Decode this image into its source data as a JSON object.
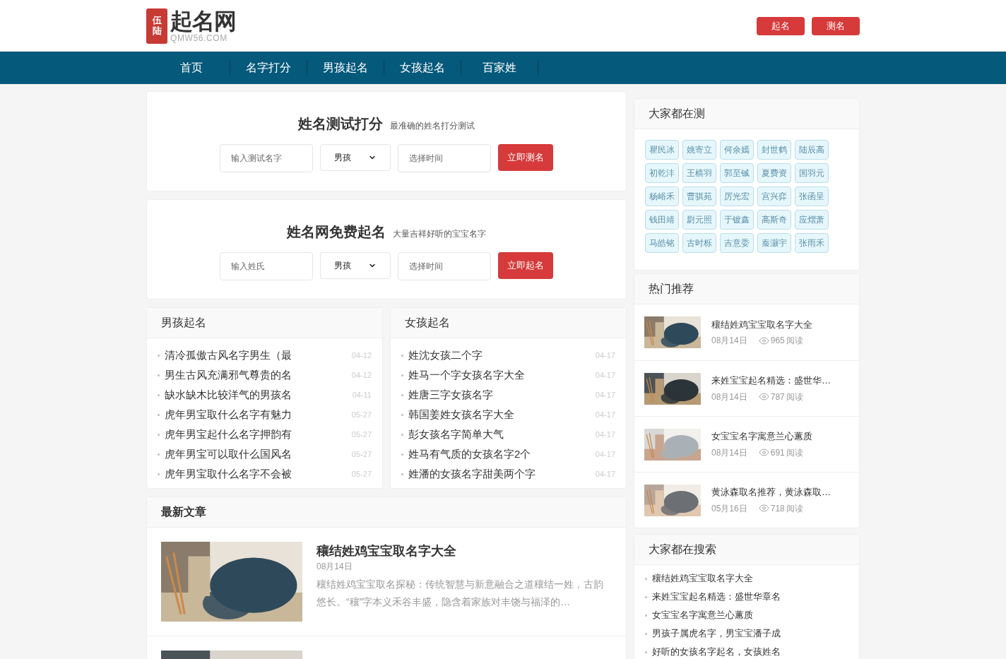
{
  "header": {
    "logo_seal": "伍陆",
    "logo_name": "起名网",
    "logo_domain": "QMW56.COM",
    "buttons": [
      "起名",
      "测名"
    ]
  },
  "nav": [
    {
      "label": "首页",
      "selected": false
    },
    {
      "label": "名字打分",
      "selected": false
    },
    {
      "label": "男孩起名",
      "selected": false
    },
    {
      "label": "女孩起名",
      "selected": false
    },
    {
      "label": "百家姓",
      "selected": false
    }
  ],
  "forms": [
    {
      "title": "姓名测试打分",
      "subtitle": "最准确的姓名打分测试",
      "name_placeholder": "输入测试名字",
      "gender": "男孩",
      "time_placeholder": "选择时间",
      "button": "立即测名"
    },
    {
      "title": "姓名网免费起名",
      "subtitle": "大量吉祥好听的宝宝名字",
      "name_placeholder": "输入姓氏",
      "gender": "男孩",
      "time_placeholder": "选择时间",
      "button": "立即起名"
    }
  ],
  "lists": [
    {
      "title": "男孩起名",
      "items": [
        {
          "text": "清冷孤傲古风名字男生（最",
          "date": "04-12"
        },
        {
          "text": "男生古风充满邪气尊贵的名",
          "date": "04-12"
        },
        {
          "text": "缺水缺木比较洋气的男孩名",
          "date": "04-11"
        },
        {
          "text": "虎年男宝取什么名字有魅力",
          "date": "05-27"
        },
        {
          "text": "虎年男宝起什么名字押韵有",
          "date": "05-27"
        },
        {
          "text": "虎年男宝可以取什么国风名",
          "date": "05-27"
        },
        {
          "text": "虎年男宝取什么名字不会被",
          "date": "05-27"
        }
      ]
    },
    {
      "title": "女孩起名",
      "items": [
        {
          "text": "姓沈女孩二个字",
          "date": "04-17"
        },
        {
          "text": "姓马一个字女孩名字大全",
          "date": "04-17"
        },
        {
          "text": "姓唐三字女孩名字",
          "date": "04-17"
        },
        {
          "text": "韩国姜姓女孩名字大全",
          "date": "04-17"
        },
        {
          "text": "彭女孩名字简单大气",
          "date": "04-17"
        },
        {
          "text": "姓马有气质的女孩名字2个",
          "date": "04-17"
        },
        {
          "text": "姓潘的女孩名字甜美两个字",
          "date": "04-17"
        }
      ]
    }
  ],
  "latest": {
    "title": "最新文章",
    "articles": [
      {
        "title": "穰结姓鸡宝宝取名字大全",
        "date": "08月14日",
        "summary": "穰结姓鸡宝宝取名探秘：传统智慧与新意融合之道穰结一姓，古韵悠长。“穰”字本义禾谷丰盛，隐含着家族对丰饶与福泽的…"
      },
      {
        "kind": "picture"
      }
    ]
  },
  "testing": {
    "title": "大家都在测",
    "names": [
      "瞿民冰",
      "姚寄立",
      "何余嫣",
      "封世鹤",
      "陆辰高",
      "初乾沣",
      "王樯羽",
      "郭至铖",
      "夏费资",
      "国羽元",
      "杨峪禾",
      "曹骐苑",
      "厉光宏",
      "宫兴弈",
      "张函呈",
      "钱田靖",
      "尉元照",
      "于镀鑫",
      "高斯奇",
      "应熠萧",
      "马皓铭",
      "古时栎",
      "吉意委",
      "秦灏宇",
      "张雨禾"
    ]
  },
  "hot": {
    "title": "热门推荐",
    "items": [
      {
        "title": "穰结姓鸡宝宝取名字大全",
        "date": "08月14日",
        "views": "965",
        "views_label": "阅读"
      },
      {
        "title": "来姓宝宝起名精选：盛世华…",
        "date": "08月14日",
        "views": "787",
        "views_label": "阅读"
      },
      {
        "title": "女宝宝名字寓意兰心蕙质",
        "date": "08月14日",
        "views": "691",
        "views_label": "阅读"
      },
      {
        "title": "黄泳森取名推荐，黄泳森取…",
        "date": "05月16日",
        "views": "718",
        "views_label": "阅读"
      }
    ]
  },
  "searches": {
    "title": "大家都在搜索",
    "items": [
      "穰结姓鸡宝宝取名字大全",
      "来姓宝宝起名精选：盛世华章名",
      "女宝宝名字寓意兰心蕙质",
      "男孩子属虎名字，男宝宝潘子成",
      "好听的女孩名字起名，女孩姓名"
    ]
  }
}
